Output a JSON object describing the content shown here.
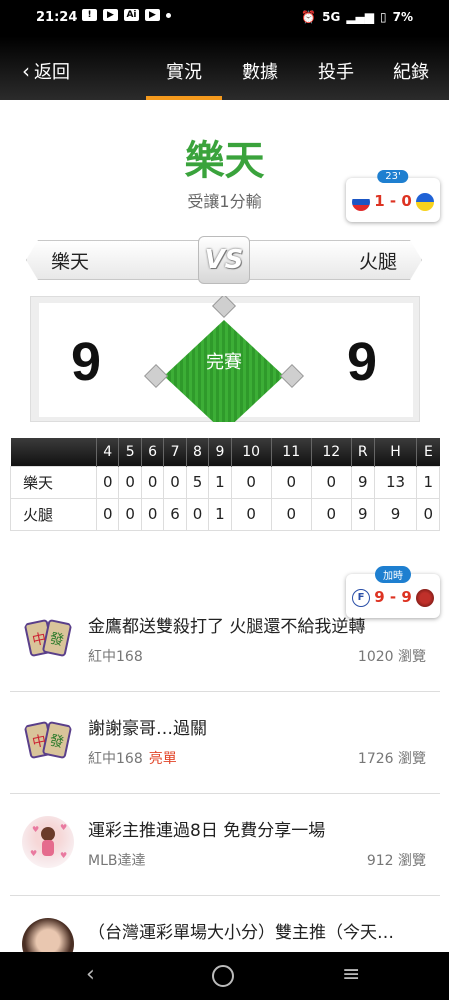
{
  "status_bar": {
    "time": "21:24",
    "icons": [
      "alert-icon",
      "youtube-icon",
      "ai-icon",
      "youtube-icon",
      "dot-icon"
    ],
    "network": "5G",
    "battery": "7%"
  },
  "nav": {
    "back_label": "返回",
    "tabs": [
      {
        "label": "實況",
        "active": true
      },
      {
        "label": "數據",
        "active": false
      },
      {
        "label": "投手",
        "active": false
      },
      {
        "label": "紀錄",
        "active": false
      }
    ],
    "accent_color": "#f59a1d"
  },
  "result": {
    "winner": "樂天",
    "handicap": "受讓1分輸",
    "winner_color": "#3aa33c"
  },
  "ad_badge_top": {
    "pill": "23'",
    "score": "1 - 0"
  },
  "matchup": {
    "home_team": "樂天",
    "vs_label": "VS",
    "away_team": "火腿"
  },
  "score": {
    "home": "9",
    "away": "9",
    "status": "完賽"
  },
  "linescore": {
    "headers": [
      "",
      "4",
      "5",
      "6",
      "7",
      "8",
      "9",
      "10",
      "11",
      "12",
      "R",
      "H",
      "E"
    ],
    "rows": [
      {
        "team": "樂天",
        "cells": [
          "0",
          "0",
          "0",
          "0",
          "5",
          "1",
          "0",
          "0",
          "0",
          "9",
          "13",
          "1"
        ]
      },
      {
        "team": "火腿",
        "cells": [
          "0",
          "0",
          "0",
          "6",
          "0",
          "1",
          "0",
          "0",
          "0",
          "9",
          "9",
          "0"
        ]
      }
    ]
  },
  "ad_badge_mid": {
    "pill": "加時",
    "score": "9 - 9"
  },
  "posts": [
    {
      "title": "金鷹都送雙殺打了 火腿還不給我逆轉",
      "author": "紅中168",
      "tag": "",
      "views": "1020 瀏覽"
    },
    {
      "title": "謝謝豪哥…過關",
      "author": "紅中168",
      "tag": "亮單",
      "views": "1726 瀏覽"
    },
    {
      "title": "運彩主推連過8日 免費分享一場",
      "author": "MLB達達",
      "tag": "",
      "views": "912 瀏覽"
    },
    {
      "title": "（台灣運彩單場大小分）雙主推（今天…",
      "author": "",
      "tag": "",
      "views": ""
    }
  ]
}
